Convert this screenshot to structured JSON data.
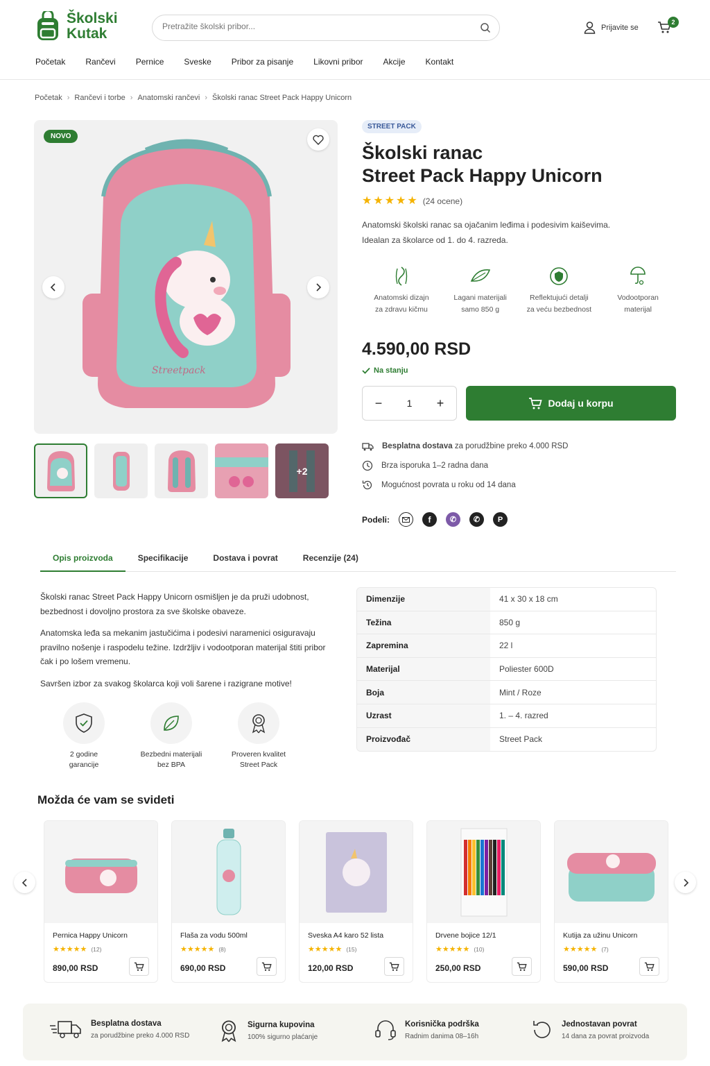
{
  "header": {
    "logo_line1": "Školski",
    "logo_line2": "Kutak",
    "search_placeholder": "Pretražite školski pribor...",
    "login_label": "Prijavite se",
    "cart_count": "2"
  },
  "nav": [
    "Početak",
    "Rančevi",
    "Pernice",
    "Sveske",
    "Pribor za pisanje",
    "Likovni pribor",
    "Akcije",
    "Kontakt"
  ],
  "breadcrumb": [
    "Početak",
    "Rančevi i torbe",
    "Anatomski rančevi",
    "Školski ranac Street Pack Happy Unicorn"
  ],
  "gallery": {
    "badge": "NOVO",
    "more_count": "+2"
  },
  "product": {
    "brand_chip": "STREET PACK",
    "title_line1": "Školski ranac",
    "title_line2": "Street Pack Happy Unicorn",
    "rating_stars": 4.5,
    "rating_text": "(24 ocene)",
    "description_line1": "Anatomski školski ranac sa ojačanim leđima i podesivim kaiševima.",
    "description_line2": "Idealan za školarce od 1. do 4. razreda.",
    "features": [
      {
        "icon": "spine-icon",
        "line1": "Anatomski dizajn",
        "line2": "za zdravu kičmu"
      },
      {
        "icon": "feather-icon",
        "line1": "Lagani materijali",
        "line2": "samo 850 g"
      },
      {
        "icon": "reflective-shield-icon",
        "line1": "Reflektujući detalji",
        "line2": "za veću bezbednost"
      },
      {
        "icon": "umbrella-drop-icon",
        "line1": "Vodootporan",
        "line2": "materijal"
      }
    ],
    "price": "4.590,00 RSD",
    "stock": "Na stanju",
    "quantity": "1",
    "add_to_cart": "Dodaj u korpu",
    "shipping": {
      "free_bold": "Besplatna dostava",
      "free_rest": " za porudžbine preko 4.000 RSD",
      "fast": "Brza isporuka 1–2 radna dana",
      "returns": "Mogućnost povrata u roku od 14 dana"
    },
    "share_label": "Podeli:"
  },
  "tabs": [
    "Opis proizvoda",
    "Specifikacije",
    "Dostava i povrat",
    "Recenzije (24)"
  ],
  "description": {
    "p1": "Školski ranac Street Pack Happy Unicorn osmišljen je da pruži udobnost, bezbednost i dovoljno prostora za sve školske obaveze.",
    "p2": "Anatomska leđa sa mekanim jastučićima i podesivi naramenici osiguravaju pravilno nošenje i raspodelu težine. Izdržljiv i vodootporan materijal štiti pribor čak i po lošem vremenu.",
    "p3": "Savršen izbor za svakog školarca koji voli šarene i razigrane motive!"
  },
  "guarantees": [
    {
      "icon": "shield-check-icon",
      "line1": "2 godine",
      "line2": "garancije"
    },
    {
      "icon": "leaf-icon",
      "line1": "Bezbedni materijali",
      "line2": "bez BPA"
    },
    {
      "icon": "award-icon",
      "line1": "Proveren kvalitet",
      "line2": "Street Pack"
    }
  ],
  "specs": [
    {
      "key": "Dimenzije",
      "value": "41 x 30 x 18 cm"
    },
    {
      "key": "Težina",
      "value": "850 g"
    },
    {
      "key": "Zapremina",
      "value": "22 l"
    },
    {
      "key": "Materijal",
      "value": "Poliester 600D"
    },
    {
      "key": "Boja",
      "value": "Mint / Roze"
    },
    {
      "key": "Uzrast",
      "value": "1. – 4. razred"
    },
    {
      "key": "Proizvođač",
      "value": "Street Pack"
    }
  ],
  "related": {
    "title": "Možda će vam se svideti",
    "items": [
      {
        "name": "Pernica Happy Unicorn",
        "rating": 4.5,
        "count": "(12)",
        "price": "890,00 RSD"
      },
      {
        "name": "Flaša za vodu 500ml",
        "rating": 4.5,
        "count": "(8)",
        "price": "690,00 RSD"
      },
      {
        "name": "Sveska A4 karo 52 lista",
        "rating": 4.5,
        "count": "(15)",
        "price": "120,00 RSD"
      },
      {
        "name": "Drvene bojice 12/1",
        "rating": 4.5,
        "count": "(10)",
        "price": "250,00 RSD"
      },
      {
        "name": "Kutija za užinu Unicorn",
        "rating": 4.5,
        "count": "(7)",
        "price": "590,00 RSD"
      }
    ]
  },
  "trust": [
    {
      "icon": "truck-icon",
      "title": "Besplatna dostava",
      "sub": "za porudžbine preko 4.000 RSD"
    },
    {
      "icon": "award-icon",
      "title": "Sigurna kupovina",
      "sub": "100% sigurno plaćanje"
    },
    {
      "icon": "headset-icon",
      "title": "Korisnička podrška",
      "sub": "Radnim danima 08–16h"
    },
    {
      "icon": "return-icon",
      "title": "Jednostavan povrat",
      "sub": "14 dana za povrat proizvoda"
    }
  ],
  "colors": {
    "brand": "#2e7d32",
    "star": "#f5b301",
    "chip_bg": "#e6edf8"
  }
}
